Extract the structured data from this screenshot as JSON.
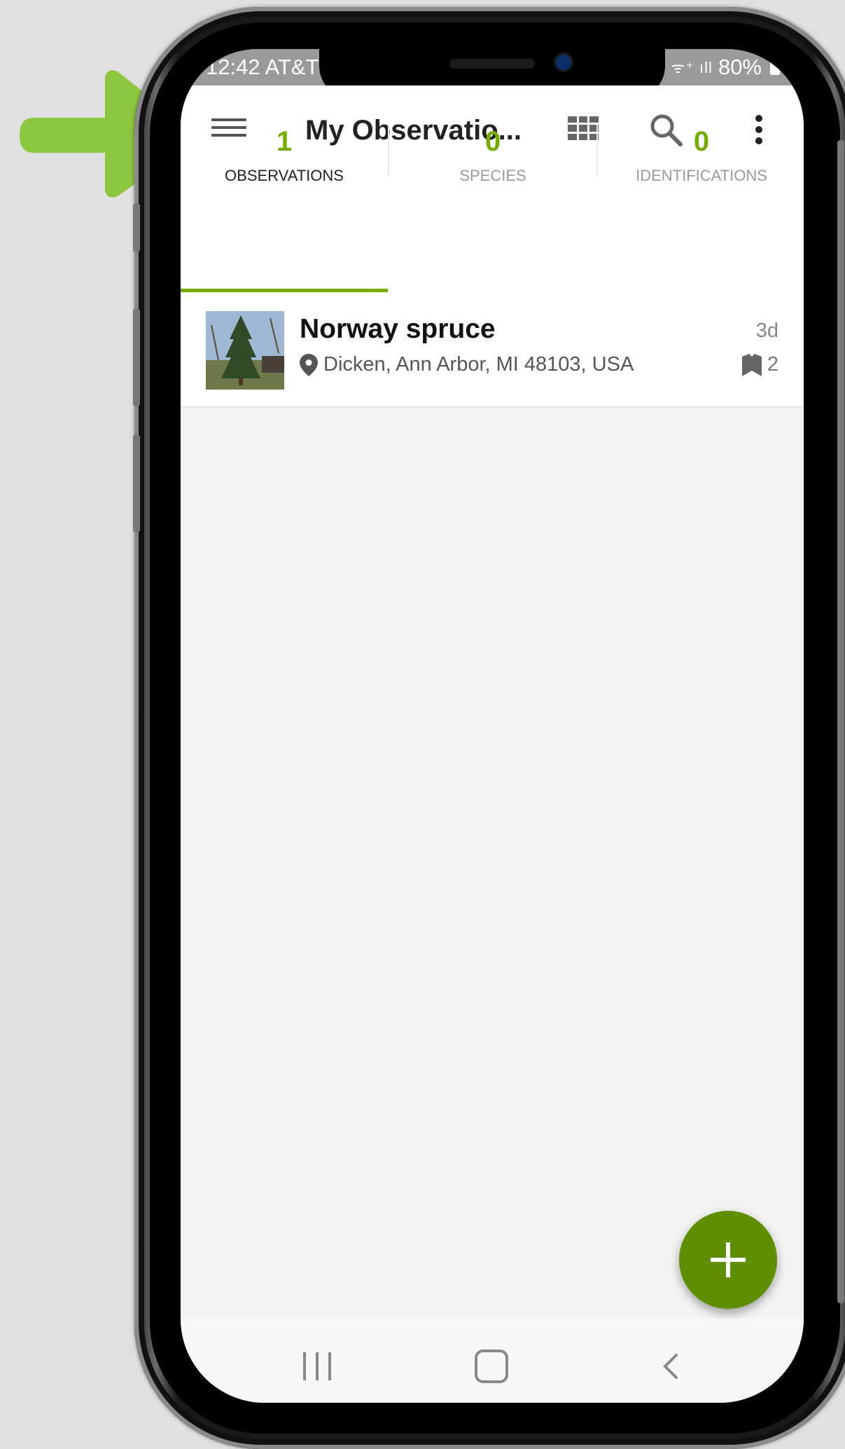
{
  "status_bar": {
    "time": "12:42 AT&T",
    "signal": "ᯤ⁺ ıll",
    "battery": "80%"
  },
  "app_bar": {
    "title": "My Observatio..."
  },
  "stats_tabs": [
    {
      "count": "1",
      "label": "OBSERVATIONS"
    },
    {
      "count": "0",
      "label": "SPECIES"
    },
    {
      "count": "0",
      "label": "IDENTIFICATIONS"
    }
  ],
  "observation": {
    "name": "Norway spruce",
    "location": "Dicken, Ann Arbor, MI 48103, USA",
    "age": "3d",
    "identification_count": "2"
  },
  "colors": {
    "accent": "#74ac00",
    "fab": "#5e8f00",
    "pointer_arrow": "#8dc63f",
    "tab_active_label": "#222222",
    "tab_inactive_label": "#9a9a9a"
  },
  "icons": {
    "menu": "menu-icon",
    "grid_view": "grid-view-icon",
    "search": "search-icon",
    "more": "more-vert-icon",
    "location": "location-pin-icon",
    "identifications": "identification-flag-icon",
    "add": "add-icon"
  }
}
